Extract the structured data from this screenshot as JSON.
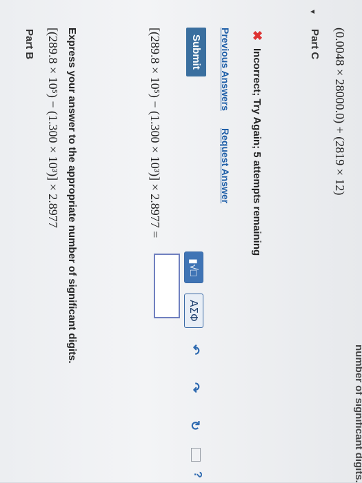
{
  "partB": {
    "title": "Part B",
    "expression": "[(289.8 × 10⁵) − (1.300 × 10³)] × 2.8977",
    "instructions": "Express your answer to the appropriate number of significant digits.",
    "toolbar": {
      "template_label": "▮√□",
      "greek_label": "ΑΣΦ",
      "help_label": "?"
    },
    "answer_prompt": "[(289.8 × 10⁵) − (1.300 × 10³)] × 2.8977 =",
    "answer_value": "",
    "submit_label": "Submit",
    "previous_answers_label": "Previous Answers",
    "request_answer_label": "Request Answer",
    "feedback": "Incorrect; Try Again; 5 attempts remaining"
  },
  "partC": {
    "title": "Part C",
    "expression": "(0.0048 × 28000.0) + (2819 × 12)",
    "instructions_partial": "number of significant digits."
  }
}
